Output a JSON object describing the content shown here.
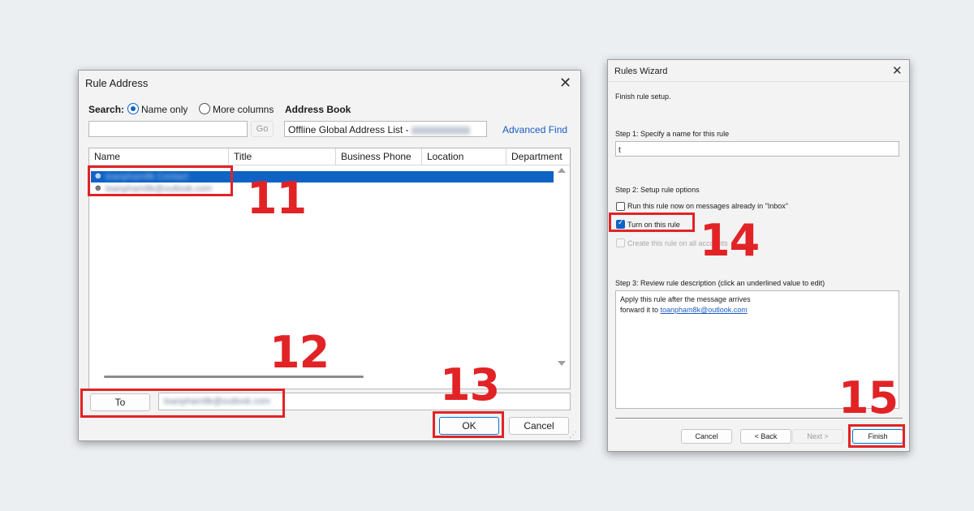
{
  "rule_address": {
    "title": "Rule Address",
    "search_label": "Search:",
    "name_only": "Name only",
    "more_columns": "More columns",
    "address_book_label": "Address Book",
    "go": "Go",
    "address_book_value": "Offline Global Address List -",
    "advanced_find": "Advanced Find",
    "columns": [
      "Name",
      "Title",
      "Business Phone",
      "Location",
      "Department"
    ],
    "rows": [
      {
        "name": "toanpham8k Contact"
      },
      {
        "name": "toanpham8k@outlook.com"
      }
    ],
    "to_button": "To",
    "to_value": "toanpham8k@outlook.com",
    "ok": "OK",
    "cancel": "Cancel"
  },
  "rules_wizard": {
    "title": "Rules Wizard",
    "finish_setup": "Finish rule setup.",
    "step1": "Step 1: Specify a name for this rule",
    "name_value": "t",
    "step2": "Step 2: Setup rule options",
    "option_run": "Run this rule now on messages already in \"Inbox\"",
    "option_turn_on": "Turn on this rule",
    "option_all_accounts": "Create this rule on all accounts",
    "step3": "Step 3: Review rule description (click an underlined value to edit)",
    "desc_line1": "Apply this rule after the message arrives",
    "desc_line2_prefix": "forward it to ",
    "desc_link": "toanpham8k@outlook.com",
    "cancel": "Cancel",
    "back": "< Back",
    "next": "Next >",
    "finish": "Finish"
  },
  "annotations": {
    "n11": "11",
    "n12": "12",
    "n13": "13",
    "n14": "14",
    "n15": "15"
  },
  "colors": {
    "accent": "#0078d4",
    "selection": "#0f63c4",
    "annotation": "#e12326",
    "link": "#1a5bc4"
  }
}
